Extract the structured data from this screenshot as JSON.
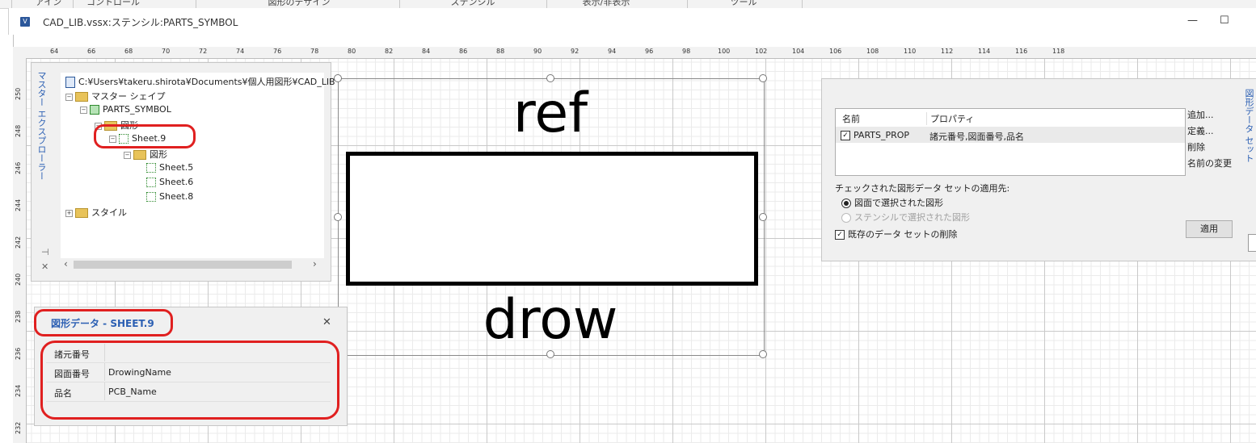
{
  "ribbon": {
    "groups": [
      "アイン",
      "コントロール",
      "図形のデザイン",
      "ステンシル",
      "表示/非表示",
      "ツール"
    ]
  },
  "window": {
    "title": "CAD_LIB.vssx:ステンシル:PARTS_SYMBOL",
    "minimize": "—",
    "maximize": "☐",
    "icon_text": "V"
  },
  "ruler": {
    "top": [
      "64",
      "66",
      "68",
      "70",
      "72",
      "74",
      "76",
      "78",
      "80",
      "82",
      "84",
      "86",
      "88",
      "90",
      "92",
      "94",
      "96",
      "98",
      "100",
      "102",
      "104",
      "106",
      "108",
      "110",
      "112",
      "114",
      "116",
      "118"
    ],
    "left": [
      "250",
      "248",
      "246",
      "244",
      "242",
      "240",
      "238",
      "236",
      "234",
      "232"
    ]
  },
  "shape": {
    "top_text": "ref",
    "bottom_text": "drow"
  },
  "explorer": {
    "title": "マスター エクスプローラー",
    "root_path": "C:¥Users¥takeru.shirota¥Documents¥個人用図形¥CAD_LIB",
    "master_shapes": "マスター シェイプ",
    "parts_symbol": "PARTS_SYMBOL",
    "shapes_folder": "図形",
    "sheet9": "Sheet.9",
    "shapes_folder2": "図形",
    "sheet5": "Sheet.5",
    "sheet6": "Sheet.6",
    "sheet8": "Sheet.8",
    "styles": "スタイル",
    "pin": "⊣",
    "close": "✕",
    "scroll_left": "‹",
    "scroll_right": "›"
  },
  "shape_data": {
    "title": "図形データ - SHEET.9",
    "close": "✕",
    "rows": [
      {
        "label": "諸元番号",
        "value": ""
      },
      {
        "label": "図面番号",
        "value": "DrowingName"
      },
      {
        "label": "品名",
        "value": "PCB_Name"
      }
    ]
  },
  "data_sets": {
    "title": "図形データ セット",
    "col_name": "名前",
    "col_property": "プロパティ",
    "row_name": "PARTS_PROP",
    "row_props": "諸元番号,図面番号,品名",
    "row_checked": true,
    "add": "追加...",
    "define": "定義...",
    "delete": "削除",
    "rename": "名前の変更",
    "apply_to_label": "チェックされた図形データ セットの適用先:",
    "opt_drawing": "図面で選択された図形",
    "opt_stencil": "ステンシルで選択された図形",
    "delete_existing": "既存のデータ セットの削除",
    "apply": "適用"
  }
}
